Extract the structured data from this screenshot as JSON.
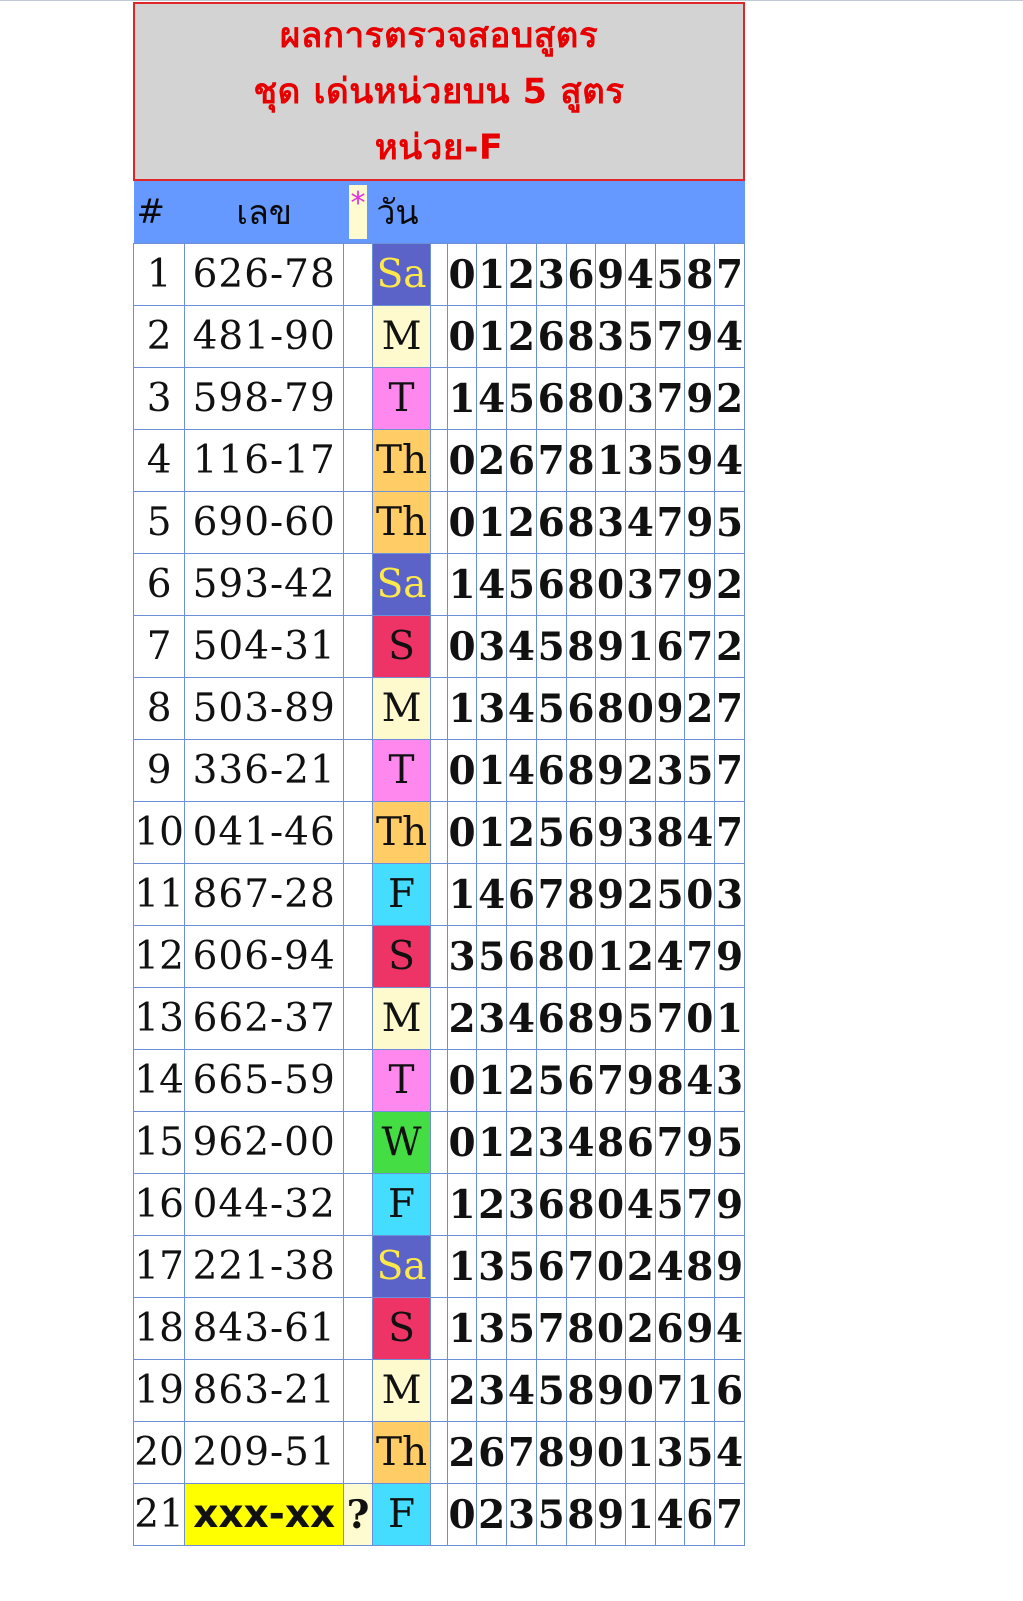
{
  "title": {
    "line1": "ผลการตรวจสอบสูตร",
    "line2": "ชุด เด่นหน่วยบน 5 สูตร",
    "line3": "หน่วย-F"
  },
  "header": {
    "hash": "#",
    "number": "เลข",
    "star": "*",
    "day": "วัน"
  },
  "colors": {
    "header_bg": "#6699ff",
    "title_bg": "#d3d3d3",
    "title_text": "#e60000",
    "highlight": "#e60000",
    "day_Sa": "#5b63c9",
    "day_M": "#fffacd",
    "day_T": "#ff88ee",
    "day_Th": "#ffcc66",
    "day_S": "#ee3366",
    "day_F": "#44ddff",
    "day_W": "#44dd44"
  },
  "rows": [
    {
      "n": "1",
      "lek": "626-78",
      "mark": "",
      "day": "Sa",
      "digits": [
        "0",
        "1",
        "2",
        "3",
        "6",
        "9",
        "4",
        "5",
        "8",
        "7"
      ],
      "hl": 4
    },
    {
      "n": "2",
      "lek": "481-90",
      "mark": "",
      "day": "M",
      "digits": [
        "0",
        "1",
        "2",
        "6",
        "8",
        "3",
        "5",
        "7",
        "9",
        "4"
      ],
      "hl": 1
    },
    {
      "n": "3",
      "lek": "598-79",
      "mark": "",
      "day": "T",
      "digits": [
        "1",
        "4",
        "5",
        "6",
        "8",
        "0",
        "3",
        "7",
        "9",
        "2"
      ],
      "hl": 4
    },
    {
      "n": "4",
      "lek": "116-17",
      "mark": "",
      "day": "Th",
      "digits": [
        "0",
        "2",
        "6",
        "7",
        "8",
        "1",
        "3",
        "5",
        "9",
        "4"
      ],
      "hl": 2
    },
    {
      "n": "5",
      "lek": "690-60",
      "mark": "",
      "day": "Th",
      "digits": [
        "0",
        "1",
        "2",
        "6",
        "8",
        "3",
        "4",
        "7",
        "9",
        "5"
      ],
      "hl": 0
    },
    {
      "n": "6",
      "lek": "593-42",
      "mark": "",
      "day": "Sa",
      "digits": [
        "1",
        "4",
        "5",
        "6",
        "8",
        "0",
        "3",
        "7",
        "9",
        "2"
      ],
      "hl": 6
    },
    {
      "n": "7",
      "lek": "504-31",
      "mark": "",
      "day": "S",
      "digits": [
        "0",
        "3",
        "4",
        "5",
        "8",
        "9",
        "1",
        "6",
        "7",
        "2"
      ],
      "hl": 2
    },
    {
      "n": "8",
      "lek": "503-89",
      "mark": "",
      "day": "M",
      "digits": [
        "1",
        "3",
        "4",
        "5",
        "6",
        "8",
        "0",
        "9",
        "2",
        "7"
      ],
      "hl": 1
    },
    {
      "n": "9",
      "lek": "336-21",
      "mark": "",
      "day": "T",
      "digits": [
        "0",
        "1",
        "4",
        "6",
        "8",
        "9",
        "2",
        "3",
        "5",
        "7"
      ],
      "hl": 3
    },
    {
      "n": "10",
      "lek": "041-46",
      "mark": "",
      "day": "Th",
      "digits": [
        "0",
        "1",
        "2",
        "5",
        "6",
        "9",
        "3",
        "8",
        "4",
        "7"
      ],
      "hl": 1
    },
    {
      "n": "11",
      "lek": "867-28",
      "mark": "",
      "day": "F",
      "digits": [
        "1",
        "4",
        "6",
        "7",
        "8",
        "9",
        "2",
        "5",
        "0",
        "3"
      ],
      "hl": 3
    },
    {
      "n": "12",
      "lek": "606-94",
      "mark": "",
      "day": "S",
      "digits": [
        "3",
        "5",
        "6",
        "8",
        "0",
        "1",
        "2",
        "4",
        "7",
        "9"
      ],
      "hl": 2
    },
    {
      "n": "13",
      "lek": "662-37",
      "mark": "",
      "day": "M",
      "digits": [
        "2",
        "3",
        "4",
        "6",
        "8",
        "9",
        "5",
        "7",
        "0",
        "1"
      ],
      "hl": 0
    },
    {
      "n": "14",
      "lek": "665-59",
      "mark": "",
      "day": "T",
      "digits": [
        "0",
        "1",
        "2",
        "5",
        "6",
        "7",
        "9",
        "8",
        "4",
        "3"
      ],
      "hl": 3
    },
    {
      "n": "15",
      "lek": "962-00",
      "mark": "",
      "day": "W",
      "digits": [
        "0",
        "1",
        "2",
        "3",
        "4",
        "8",
        "6",
        "7",
        "9",
        "5"
      ],
      "hl": 2
    },
    {
      "n": "16",
      "lek": "044-32",
      "mark": "",
      "day": "F",
      "digits": [
        "1",
        "2",
        "3",
        "6",
        "8",
        "0",
        "4",
        "5",
        "7",
        "9"
      ],
      "hl": 6
    },
    {
      "n": "17",
      "lek": "221-38",
      "mark": "",
      "day": "Sa",
      "digits": [
        "1",
        "3",
        "5",
        "6",
        "7",
        "0",
        "2",
        "4",
        "8",
        "9"
      ],
      "hl": 0
    },
    {
      "n": "18",
      "lek": "843-61",
      "mark": "",
      "day": "S",
      "digits": [
        "1",
        "3",
        "5",
        "7",
        "8",
        "0",
        "2",
        "6",
        "9",
        "4"
      ],
      "hl": 1
    },
    {
      "n": "19",
      "lek": "863-21",
      "mark": "",
      "day": "M",
      "digits": [
        "2",
        "3",
        "4",
        "5",
        "8",
        "9",
        "0",
        "7",
        "1",
        "6"
      ],
      "hl": 1
    },
    {
      "n": "20",
      "lek": "209-51",
      "mark": "",
      "day": "Th",
      "digits": [
        "2",
        "6",
        "7",
        "8",
        "9",
        "0",
        "1",
        "3",
        "5",
        "4"
      ],
      "hl": 4
    },
    {
      "n": "21",
      "lek": "xxx-xx",
      "mark": "?",
      "day": "F",
      "digits": [
        "0",
        "2",
        "3",
        "5",
        "8",
        "9",
        "1",
        "4",
        "6",
        "7"
      ],
      "hl": -1
    }
  ]
}
